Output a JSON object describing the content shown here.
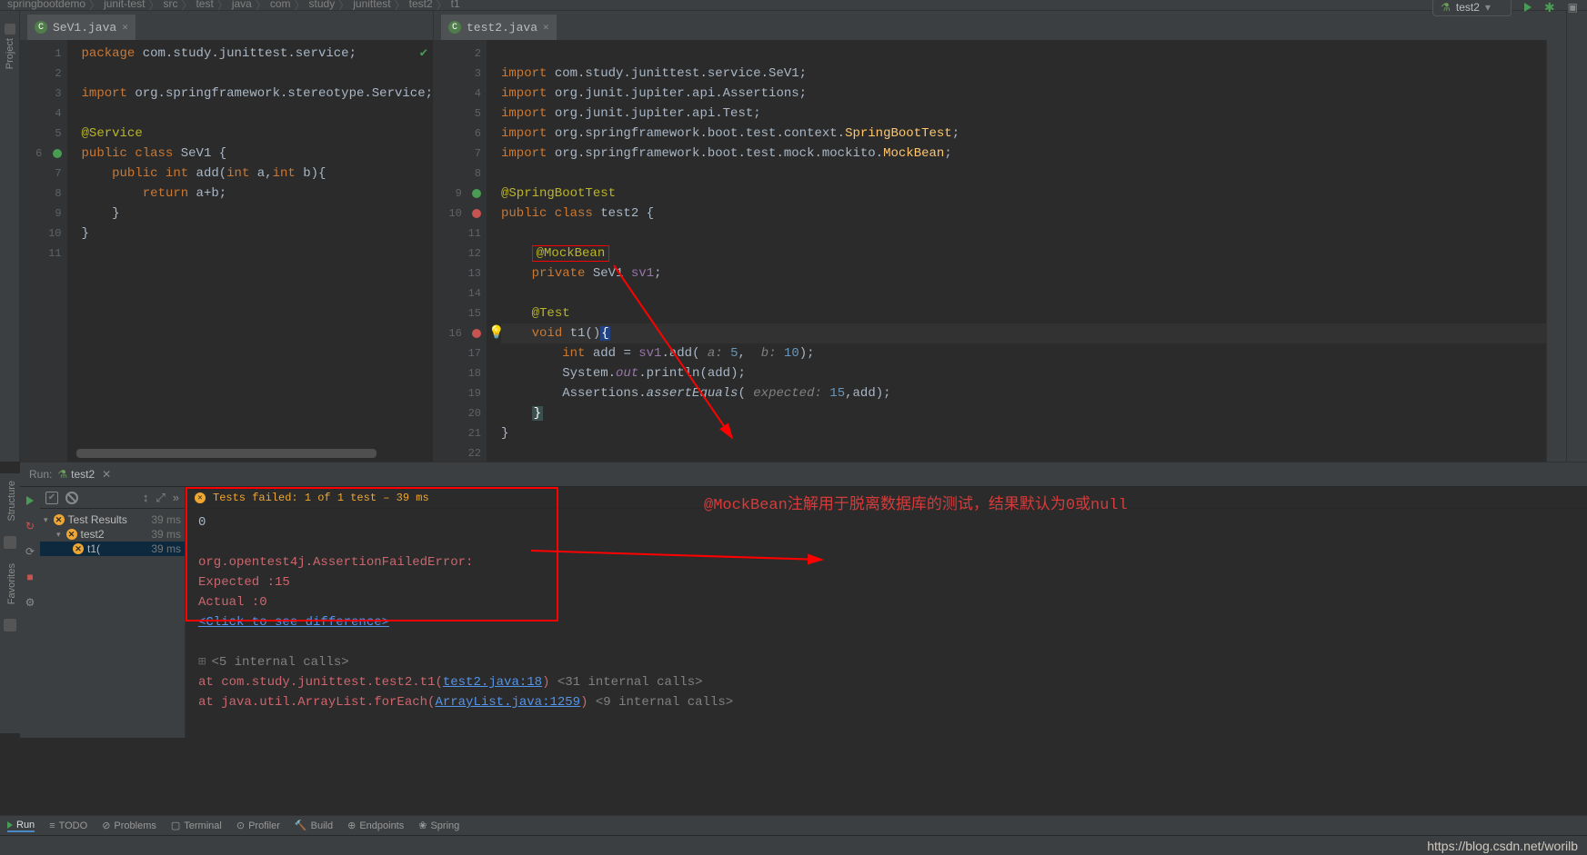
{
  "breadcrumb": [
    "springbootdemo",
    "junit-test",
    "src",
    "test",
    "java",
    "com",
    "study",
    "junittest",
    "test2",
    "t1"
  ],
  "run_config": "test2",
  "left_editor": {
    "tab": "SeV1.java",
    "lines": {
      "pkg": "package com.study.junittest.service;",
      "imp": "import org.springframework.stereotype.Service;",
      "ann": "@Service",
      "cls_open": "public class SeV1 {",
      "method": "    public int add(int a,int b){",
      "ret": "        return a+b;",
      "cb1": "    }",
      "cb2": "}"
    }
  },
  "right_editor": {
    "tab": "test2.java",
    "imp1": "import com.study.junittest.service.SeV1;",
    "imp2": "import org.junit.jupiter.api.Assertions;",
    "imp3": "import org.junit.jupiter.api.Test;",
    "imp4": "import org.springframework.boot.test.context.SpringBootTest;",
    "imp5": "import org.springframework.boot.test.mock.mockito.MockBean;",
    "sbt": "@SpringBootTest",
    "cls": "public class test2 {",
    "mockbean": "@MockBean",
    "fld": "private SeV1 sv1;",
    "test": "@Test",
    "method": "void t1(){",
    "l1a": "int add = sv1.add(",
    "l1p1": " a: ",
    "l1v1": "5",
    "l1m": ", ",
    "l1p2": " b: ",
    "l1v2": "10",
    "l1e": ");",
    "l2a": "System.",
    "l2b": "out",
    "l2c": ".println(add);",
    "l3a": "Assertions.",
    "l3b": "assertEquals",
    "l3c": "(",
    "l3p": " expected: ",
    "l3v": "15",
    "l3d": ",add);",
    "cb1": "}",
    "cb2": "}"
  },
  "run_tab": {
    "label": "Run:",
    "name": "test2"
  },
  "test_tree": {
    "root": "Test Results",
    "root_dur": "39 ms",
    "n1": "test2",
    "n1_dur": "39 ms",
    "n2": "t1(",
    "n2_dur": "39 ms"
  },
  "console": {
    "status": "Tests failed: 1 of 1 test – 39 ms",
    "out0": "0",
    "err_head": "org.opentest4j.AssertionFailedError: ",
    "exp": "Expected :15",
    "act": "Actual   :0",
    "diff": "<Click to see difference>",
    "fold": "<5 internal calls>",
    "st1a": "    at com.study.junittest.test2.t1(",
    "st1l": "test2.java:18",
    "st1b": ") ",
    "st1c": "<31 internal calls>",
    "st2a": "    at java.util.ArrayList.forEach(",
    "st2l": "ArrayList.java:1259",
    "st2b": ") ",
    "st2c": "<9 internal calls>"
  },
  "annotation_cn": "@MockBean注解用于脱离数据库的测试，结果默认为0或null",
  "bottom_tabs": [
    "Run",
    "TODO",
    "Problems",
    "Terminal",
    "Profiler",
    "Build",
    "Endpoints",
    "Spring"
  ],
  "side_tools": {
    "project": "Project",
    "structure": "Structure",
    "favorites": "Favorites"
  },
  "watermark": "https://blog.csdn.net/worilb"
}
